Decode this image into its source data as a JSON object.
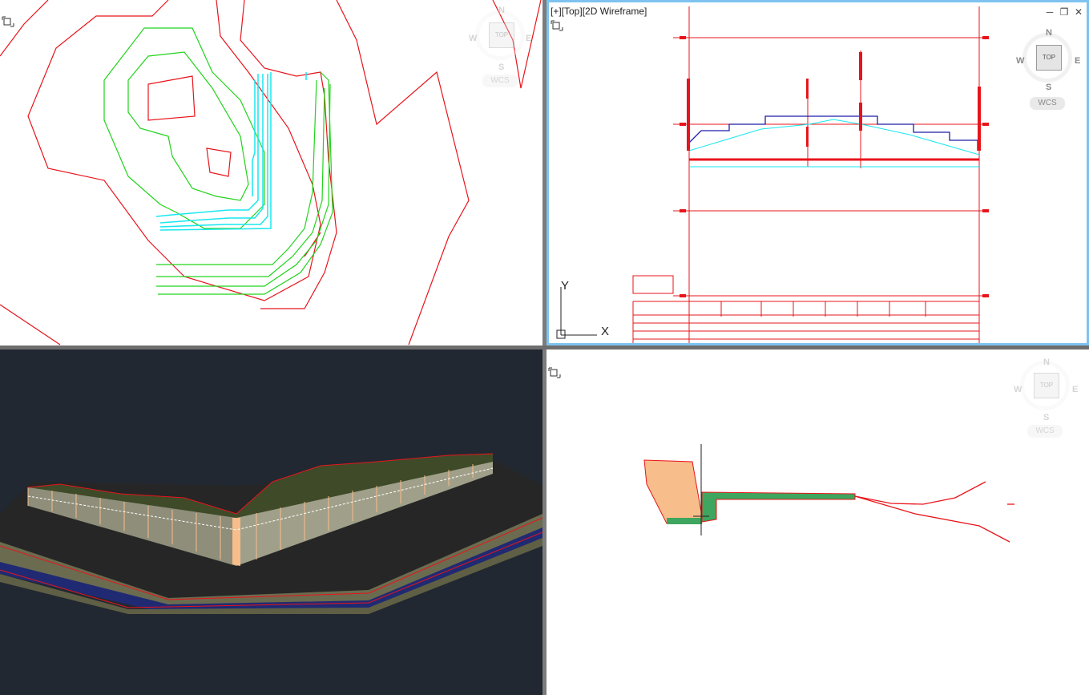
{
  "viewports": {
    "top_left": {
      "name": "contour-plan-viewport",
      "compass": {
        "n": "N",
        "s": "S",
        "e": "E",
        "w": "W",
        "face": "TOP",
        "wcs": "WCS"
      }
    },
    "top_right": {
      "label": "[+][Top][2D Wireframe]",
      "compass": {
        "n": "N",
        "s": "S",
        "e": "E",
        "w": "W",
        "face": "TOP",
        "wcs": "WCS"
      },
      "ucs": {
        "x": "X",
        "y": "Y"
      }
    },
    "bottom_left": {
      "name": "3d-render-viewport"
    },
    "bottom_right": {
      "compass": {
        "n": "N",
        "s": "S",
        "e": "E",
        "w": "W",
        "face": "TOP",
        "wcs": "WCS"
      }
    }
  },
  "colors": {
    "accent_active": "#7ec3f0",
    "contour_red": "#e8141b",
    "contour_green": "#22d31c",
    "road_cyan": "#19e7ef",
    "profile_blue": "#1f1faa",
    "fill_orange": "#f7bd8a",
    "fill_green": "#3ea65e"
  }
}
